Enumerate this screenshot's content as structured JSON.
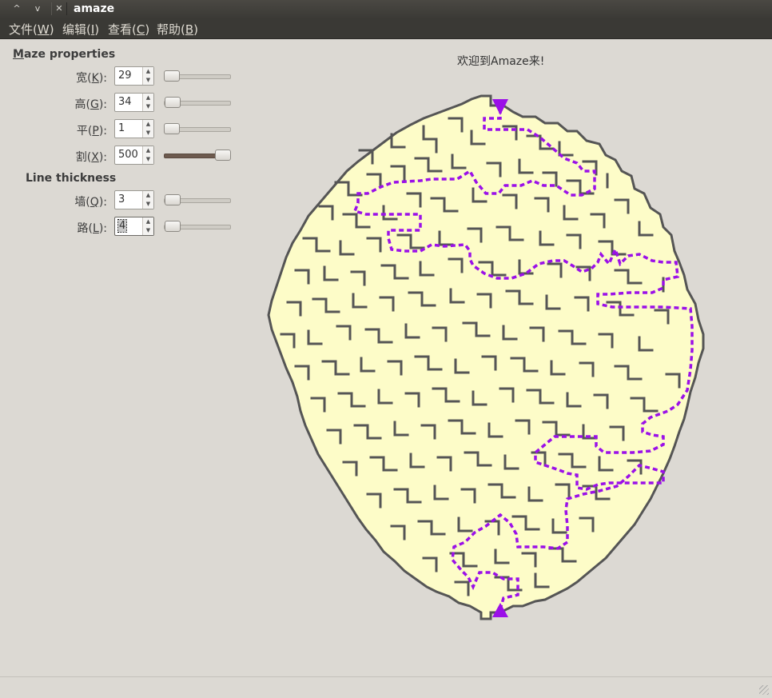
{
  "window": {
    "title": "amaze"
  },
  "menu": [
    {
      "label": "文件(",
      "mn": "W",
      "end": ")"
    },
    {
      "label": "编辑(",
      "mn": "I",
      "end": ")"
    },
    {
      "label": "查看(",
      "mn": "C",
      "end": ")"
    },
    {
      "label": "帮助(",
      "mn": "B",
      "end": ")"
    }
  ],
  "props": {
    "heading_first": "M",
    "heading_rest": "aze properties",
    "width": {
      "label": "宽(",
      "mn": "K",
      "end": "):",
      "value": "29"
    },
    "height": {
      "label": "高(",
      "mn": "G",
      "end": "):",
      "value": "34"
    },
    "flat": {
      "label": "平(",
      "mn": "P",
      "end": "):",
      "value": "1"
    },
    "cut": {
      "label": "割(",
      "mn": "X",
      "end": "):",
      "value": "500"
    }
  },
  "line": {
    "heading": "Line thickness",
    "wall": {
      "label": "墙(",
      "mn": "Q",
      "end": "):",
      "value": "3"
    },
    "road": {
      "label": "路(",
      "mn": "L",
      "end": "):",
      "value": "4"
    }
  },
  "welcome": "欢迎到Amaze来!",
  "colors": {
    "maze_fill": "#fdfcc8",
    "maze_wall": "#555555",
    "path": "#9b10e8"
  }
}
